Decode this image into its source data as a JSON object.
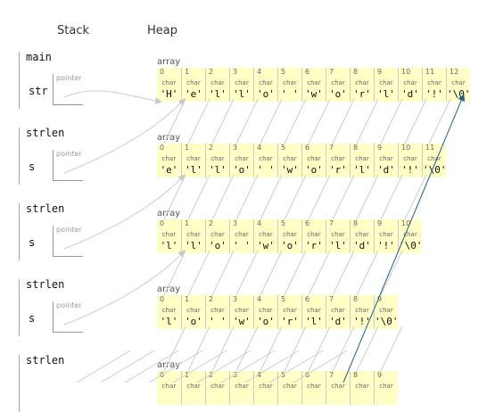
{
  "headers": {
    "stack": "Stack",
    "heap": "Heap"
  },
  "frames": [
    {
      "func": "main",
      "var": "str",
      "ptr_label": "pointer"
    },
    {
      "func": "strlen",
      "var": "s",
      "ptr_label": "pointer"
    },
    {
      "func": "strlen",
      "var": "s",
      "ptr_label": "pointer"
    },
    {
      "func": "strlen",
      "var": "s",
      "ptr_label": "pointer"
    },
    {
      "func": "strlen",
      "var": "",
      "ptr_label": ""
    }
  ],
  "arrays": [
    {
      "label": "array",
      "type": "char",
      "values": [
        "'H'",
        "'e'",
        "'l'",
        "'l'",
        "'o'",
        "' '",
        "'w'",
        "'o'",
        "'r'",
        "'l'",
        "'d'",
        "'!'",
        "'\\0'"
      ]
    },
    {
      "label": "array",
      "type": "char",
      "values": [
        "'e'",
        "'l'",
        "'l'",
        "'o'",
        "' '",
        "'w'",
        "'o'",
        "'r'",
        "'l'",
        "'d'",
        "'!'",
        "'\\0'"
      ]
    },
    {
      "label": "array",
      "type": "char",
      "values": [
        "'l'",
        "'l'",
        "'o'",
        "' '",
        "'w'",
        "'o'",
        "'r'",
        "'l'",
        "'d'",
        "'!'",
        "'\\0'"
      ]
    },
    {
      "label": "array",
      "type": "char",
      "values": [
        "'l'",
        "'o'",
        "' '",
        "'w'",
        "'o'",
        "'r'",
        "'l'",
        "'d'",
        "'!'",
        "'\\0'"
      ]
    },
    {
      "label": "array",
      "type": "char",
      "values": [
        "",
        "",
        "",
        "",
        "",
        "",
        "",
        "",
        "",
        ""
      ]
    }
  ],
  "colors": {
    "highlight_arrow": "#1f5f8a",
    "ptr_arrow": "#cccccc",
    "cell_bg": "#ffffc6"
  }
}
